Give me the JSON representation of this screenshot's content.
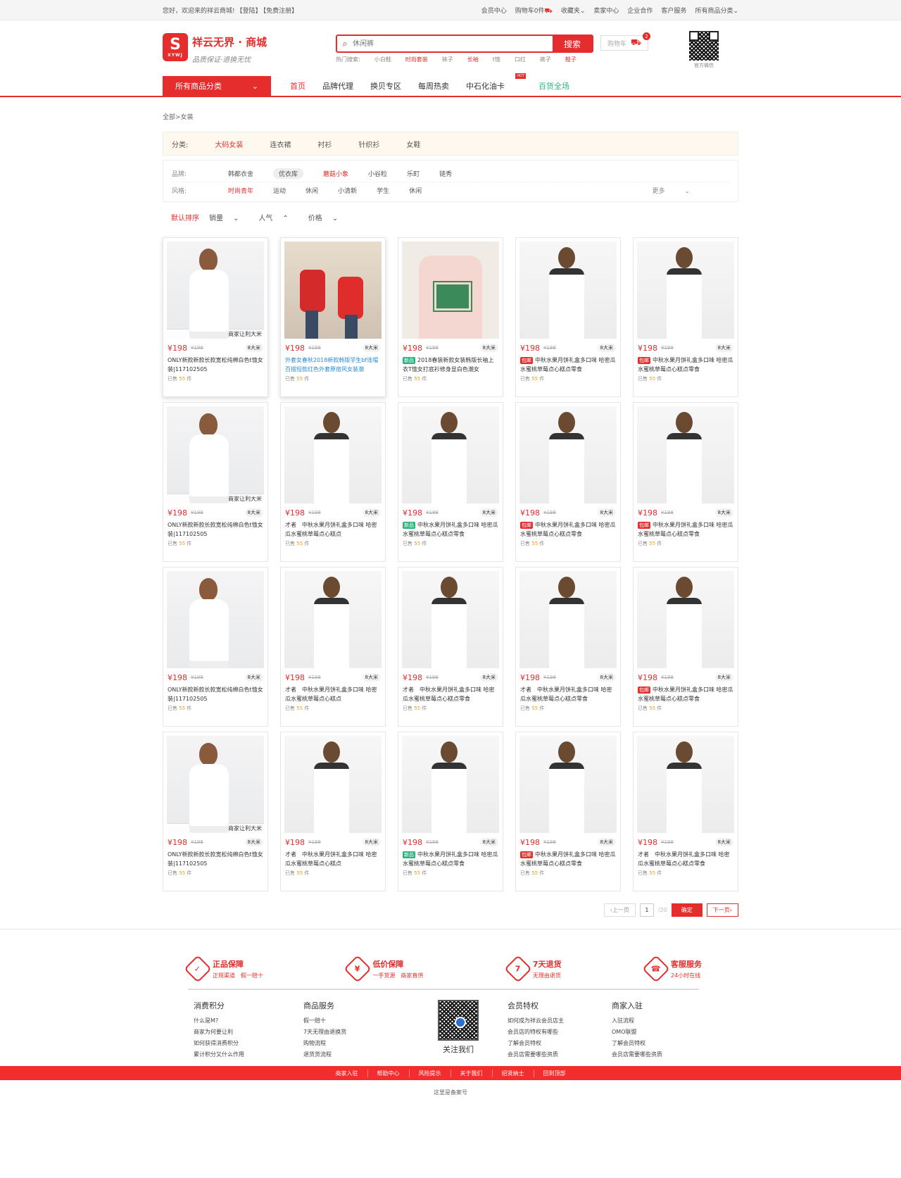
{
  "topbar": {
    "welcome": "您好，欢迎来的祥云商城!",
    "login": "【登陆】",
    "register": "【免费注册】",
    "links": [
      "会员中心",
      "购物车0件",
      "收藏夹",
      "卖家中心",
      "企业合作",
      "客户服务",
      "所有商品分类"
    ]
  },
  "header": {
    "logo_mark": "S",
    "logo_sub": "XYWJ",
    "logo_title": "祥云无界 · 商城",
    "logo_slogan": "品质保证·退换无忧",
    "search_placeholder": "休闲裤",
    "search_button": "搜索",
    "hot_label": "热门搜索:",
    "hot_words": [
      {
        "text": "小白鞋",
        "red": false
      },
      {
        "text": "时尚套装",
        "red": true
      },
      {
        "text": "袜子",
        "red": false
      },
      {
        "text": "长袖",
        "red": true
      },
      {
        "text": "t恤",
        "red": false
      },
      {
        "text": "口红",
        "red": false
      },
      {
        "text": "裤子",
        "red": false
      },
      {
        "text": "鞋子",
        "red": true
      }
    ],
    "cart_label": "购物车",
    "cart_count": "2",
    "qr_label": "官方微信"
  },
  "nav": {
    "all_categories": "所有商品分类",
    "items": [
      "首页",
      "品牌代理",
      "换贝专区",
      "每周热卖",
      "中石化油卡",
      "百货全场"
    ],
    "hot_tag": "HOT"
  },
  "breadcrumb": "全部>女装",
  "category": {
    "label": "分类:",
    "items": [
      "大码女装",
      "连衣裙",
      "衬衫",
      "针织衫",
      "女鞋"
    ]
  },
  "filters": {
    "brand_label": "品牌:",
    "brands": [
      "韩都衣舍",
      "优衣库",
      "蘑菇小象",
      "小谷粒",
      "乐町",
      "链秀"
    ],
    "style_label": "风格:",
    "styles": [
      "时尚青年",
      "运动",
      "休闲",
      "小清新",
      "学生",
      "休闲"
    ],
    "more": "更多"
  },
  "sort": [
    "默认排序",
    "销量",
    "人气",
    "价格"
  ],
  "products": [
    {
      "img": "dress",
      "overlay": "商家让利大米",
      "price": "¥198",
      "oprice": "¥198",
      "tag": "8大米",
      "badge": "",
      "title": "ONLY新款新款长款宽松纯棉白色t恤女装|117102505",
      "sold_label": "已售",
      "sold": "55",
      "unit": "件",
      "shadow": true
    },
    {
      "img": "couple",
      "overlay": "",
      "price": "¥198",
      "oprice": "¥198",
      "tag": "8大米",
      "badge": "",
      "title": "外套女春秋2018新款韩版学生bf连帽百搭短款红色外套原宿风女装潮",
      "sold_label": "已售",
      "sold": "55",
      "unit": "件",
      "shadow": true,
      "blue": true
    },
    {
      "img": "tee",
      "overlay": "",
      "price": "¥198",
      "oprice": "¥198",
      "tag": "8大米",
      "badge": "新品",
      "badge_color": "green",
      "title": "2018春装新款女装韩版长袖上衣T恤女打底衫修身显白色潮女",
      "sold_label": "已售",
      "sold": "55",
      "unit": "件"
    },
    {
      "img": "whitedress",
      "overlay": "",
      "price": "¥198",
      "oprice": "¥198",
      "tag": "8大米",
      "badge": "包邮",
      "badge_color": "red",
      "title": "中秋水果月饼礼盒多口味 哈密瓜水蜜桃草莓点心糕点零食",
      "sold_label": "已售",
      "sold": "55",
      "unit": "件"
    },
    {
      "img": "whitedress",
      "overlay": "",
      "price": "¥198",
      "oprice": "¥198",
      "tag": "8大米",
      "badge": "包邮",
      "badge_color": "red",
      "title": "中秋水果月饼礼盒多口味 哈密瓜水蜜桃草莓点心糕点零食",
      "sold_label": "已售",
      "sold": "55",
      "unit": "件"
    },
    {
      "img": "dress",
      "overlay": "商家让利大米",
      "price": "¥198",
      "oprice": "¥198",
      "tag": "8大米",
      "badge": "",
      "title": "ONLY新款新款长款宽松纯棉白色t恤女装|117102505",
      "sold_label": "已售",
      "sold": "55",
      "unit": "件"
    },
    {
      "img": "whitedress",
      "overlay": "",
      "price": "¥198",
      "oprice": "¥198",
      "tag": "8大米",
      "badge": "",
      "title": "才者　中秋水果月饼礼盒多口味 哈密瓜水蜜桃草莓点心糕点",
      "sold_label": "已售",
      "sold": "55",
      "unit": "件"
    },
    {
      "img": "whitedress",
      "overlay": "",
      "price": "¥198",
      "oprice": "¥198",
      "tag": "8大米",
      "badge": "新品",
      "badge_color": "green",
      "title": "中秋水果月饼礼盒多口味 哈密瓜水蜜桃草莓点心糕点零食",
      "sold_label": "已售",
      "sold": "55",
      "unit": "件"
    },
    {
      "img": "whitedress",
      "overlay": "",
      "price": "¥198",
      "oprice": "¥198",
      "tag": "8大米",
      "badge": "包邮",
      "badge_color": "red",
      "title": "中秋水果月饼礼盒多口味 哈密瓜水蜜桃草莓点心糕点零食",
      "sold_label": "已售",
      "sold": "55",
      "unit": "件"
    },
    {
      "img": "whitedress",
      "overlay": "",
      "price": "¥198",
      "oprice": "¥198",
      "tag": "8大米",
      "badge": "包邮",
      "badge_color": "red",
      "title": "中秋水果月饼礼盒多口味 哈密瓜水蜜桃草莓点心糕点零食",
      "sold_label": "已售",
      "sold": "55",
      "unit": "件"
    },
    {
      "img": "dress",
      "overlay": "",
      "price": "¥198",
      "oprice": "¥198",
      "tag": "8大米",
      "badge": "",
      "title": "ONLY新款新款长款宽松纯棉白色t恤女装|117102505",
      "sold_label": "已售",
      "sold": "55",
      "unit": "件"
    },
    {
      "img": "whitedress",
      "overlay": "",
      "price": "¥198",
      "oprice": "¥198",
      "tag": "8大米",
      "badge": "",
      "title": "才者　中秋水果月饼礼盒多口味 哈密瓜水蜜桃草莓点心糕点",
      "sold_label": "已售",
      "sold": "55",
      "unit": "件"
    },
    {
      "img": "whitedress",
      "overlay": "",
      "price": "¥198",
      "oprice": "¥198",
      "tag": "8大米",
      "badge": "",
      "title": "才者　中秋水果月饼礼盒多口味 哈密瓜水蜜桃草莓点心糕点零食",
      "sold_label": "已售",
      "sold": "55",
      "unit": "件"
    },
    {
      "img": "whitedress",
      "overlay": "",
      "price": "¥198",
      "oprice": "¥198",
      "tag": "8大米",
      "badge": "",
      "title": "才者　中秋水果月饼礼盒多口味 哈密瓜水蜜桃草莓点心糕点零食",
      "sold_label": "已售",
      "sold": "55",
      "unit": "件"
    },
    {
      "img": "whitedress",
      "overlay": "",
      "price": "¥198",
      "oprice": "¥198",
      "tag": "8大米",
      "badge": "包邮",
      "badge_color": "red",
      "title": "中秋水果月饼礼盒多口味 哈密瓜水蜜桃草莓点心糕点零食",
      "sold_label": "已售",
      "sold": "55",
      "unit": "件"
    },
    {
      "img": "dress",
      "overlay": "商家让利大米",
      "price": "¥198",
      "oprice": "¥198",
      "tag": "8大米",
      "badge": "",
      "title": "ONLY新款新款长款宽松纯棉白色t恤女装|117102505",
      "sold_label": "已售",
      "sold": "55",
      "unit": "件"
    },
    {
      "img": "whitedress",
      "overlay": "",
      "price": "¥198",
      "oprice": "¥198",
      "tag": "8大米",
      "badge": "",
      "title": "才者　中秋水果月饼礼盒多口味 哈密瓜水蜜桃草莓点心糕点",
      "sold_label": "已售",
      "sold": "55",
      "unit": "件"
    },
    {
      "img": "whitedress",
      "overlay": "",
      "price": "¥198",
      "oprice": "¥198",
      "tag": "8大米",
      "badge": "新品",
      "badge_color": "green",
      "title": "中秋水果月饼礼盒多口味 哈密瓜水蜜桃草莓点心糕点零食",
      "sold_label": "已售",
      "sold": "55",
      "unit": "件"
    },
    {
      "img": "whitedress",
      "overlay": "",
      "price": "¥198",
      "oprice": "¥198",
      "tag": "8大米",
      "badge": "包邮",
      "badge_color": "red",
      "title": "中秋水果月饼礼盒多口味 哈密瓜水蜜桃草莓点心糕点零食",
      "sold_label": "已售",
      "sold": "55",
      "unit": "件"
    },
    {
      "img": "whitedress",
      "overlay": "",
      "price": "¥198",
      "oprice": "¥198",
      "tag": "8大米",
      "badge": "",
      "title": "才者　中秋水果月饼礼盒多口味 哈密瓜水蜜桃草莓点心糕点零食",
      "sold_label": "已售",
      "sold": "55",
      "unit": "件"
    }
  ],
  "pager": {
    "prev": "上一页",
    "current": "1",
    "total": "/20",
    "ok": "确定",
    "next": "下一页"
  },
  "services": [
    {
      "icon": "shield-icon",
      "glyph": "✓",
      "title": "正品保障",
      "desc": "正规渠道　假一赔十"
    },
    {
      "icon": "price-tag-icon",
      "glyph": "¥",
      "title": "低价保障",
      "desc": "一手货源　商家直供"
    },
    {
      "icon": "return-box-icon",
      "glyph": "7",
      "title": "7天退货",
      "desc": "无理由退货"
    },
    {
      "icon": "headset-icon",
      "glyph": "☎",
      "title": "客服服务",
      "desc": "24小时在线"
    }
  ],
  "footer_cols": [
    {
      "title": "消费积分",
      "items": [
        "什么是M?",
        "商家为何要让利",
        "如何获得消费积分",
        "累计积分又什么作用"
      ]
    },
    {
      "title": "商品服务",
      "items": [
        "假一赔十",
        "7天无理由退换货",
        "购物流程",
        "退货货流程"
      ]
    },
    {
      "title": "会员特权",
      "items": [
        "如何成为祥云会员店主",
        "会员店的特权有哪些",
        "了解会员特权",
        "会员店需要哪些资质"
      ]
    },
    {
      "title": "商家入驻",
      "items": [
        "入驻流程",
        "OMO联盟",
        "了解会员特权",
        "会员店需要哪些资质"
      ]
    }
  ],
  "follow": "关注我们",
  "bottom_links": [
    "商家入驻",
    "帮助中心",
    "风险提示",
    "关于我们",
    "招贤纳士",
    "回到顶部"
  ],
  "icp": "这里是备案号"
}
